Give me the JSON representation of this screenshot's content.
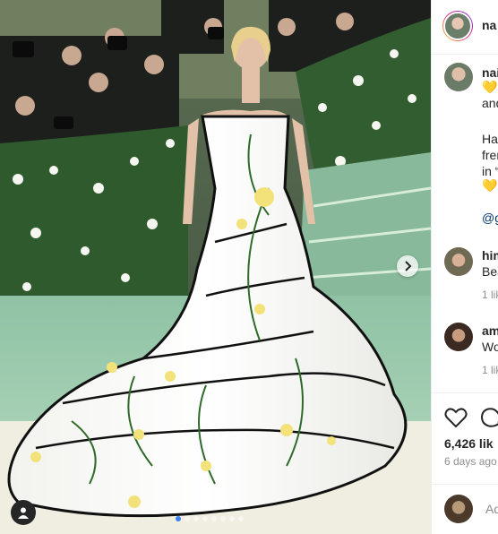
{
  "post": {
    "author": "na",
    "carousel_count": 8,
    "carousel_index": 0
  },
  "caption": {
    "author": "nai",
    "line1": "💛",
    "line2": "and",
    "line3": "Har",
    "line4": "fren",
    "line5": "in “",
    "line6": "💛",
    "line7": "@g"
  },
  "comments": [
    {
      "author": "him",
      "text": "Bea",
      "meta": "1 lik"
    },
    {
      "author": "am",
      "text": "Wo",
      "meta": "1 lik"
    }
  ],
  "footer": {
    "likes": "6,426 lik",
    "time": "6 days ago",
    "add_comment_placeholder": "Ad"
  },
  "colors": {
    "text": "#262626",
    "muted": "#8e8e8e",
    "link": "#00376b",
    "border": "#efefef",
    "dot_active": "#3b82f6"
  },
  "icons": {
    "next": "chevron-right-icon",
    "tag": "user-tag-icon",
    "like": "heart-icon",
    "comment": "comment-icon"
  }
}
